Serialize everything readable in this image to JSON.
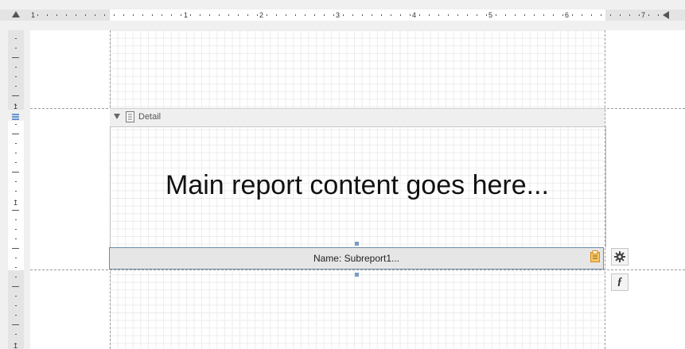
{
  "ruler": {
    "numbers": [
      "1",
      "1",
      "2",
      "3",
      "4",
      "5",
      "6",
      "7"
    ]
  },
  "vruler": {
    "numbers": [
      "1",
      "1",
      "1"
    ]
  },
  "band": {
    "title": "Detail"
  },
  "content": {
    "main_text": "Main report content goes here...",
    "subreport_label": "Name: Subreport1..."
  },
  "icons": {
    "collapse": "collapse-triangle-icon",
    "band": "band-icon",
    "subreport": "clipboard-icon",
    "settings": "gear-icon",
    "expression": "function-icon"
  },
  "colors": {
    "grid": "#ececec",
    "selection": "#6b8cae",
    "accent": "#f0a02b"
  }
}
